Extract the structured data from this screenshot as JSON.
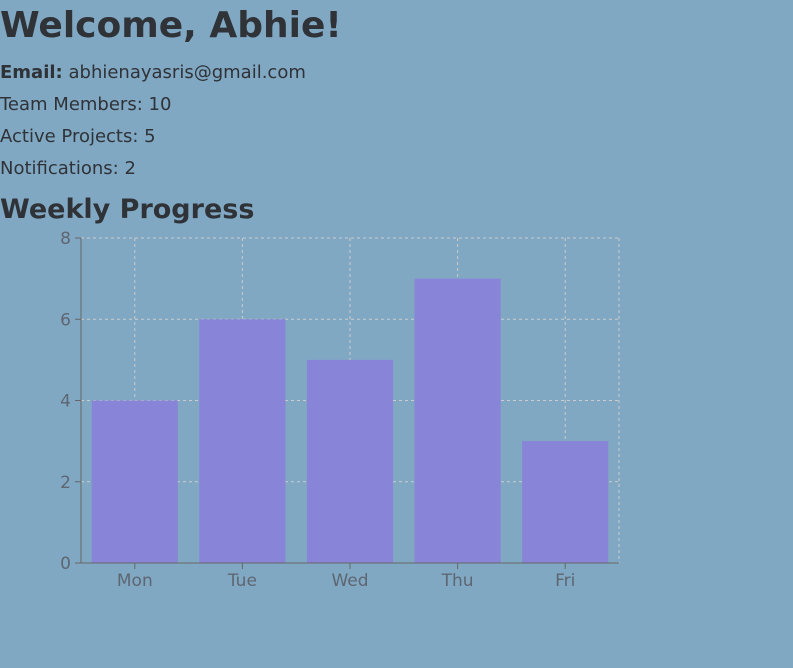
{
  "header": {
    "title": "Welcome, Abhie!"
  },
  "profile": {
    "email_label": "Email:",
    "email_value": "abhienayasris@gmail.com",
    "team_members": "Team Members: 10",
    "active_projects": "Active Projects: 5",
    "notifications": "Notifications: 2"
  },
  "section": {
    "title": "Weekly Progress"
  },
  "colors": {
    "background": "#80a8c3",
    "bar": "#8884d8",
    "text": "#2f3237",
    "axis": "#666666",
    "grid": "#cccccc"
  },
  "chart_data": {
    "type": "bar",
    "categories": [
      "Mon",
      "Tue",
      "Wed",
      "Thu",
      "Fri"
    ],
    "values": [
      4,
      6,
      5,
      7,
      3
    ],
    "yticks": [
      "0",
      "2",
      "4",
      "6",
      "8"
    ],
    "ylim": [
      0,
      8
    ],
    "grid": true,
    "legend": "none",
    "title": "",
    "xlabel": "",
    "ylabel": ""
  }
}
